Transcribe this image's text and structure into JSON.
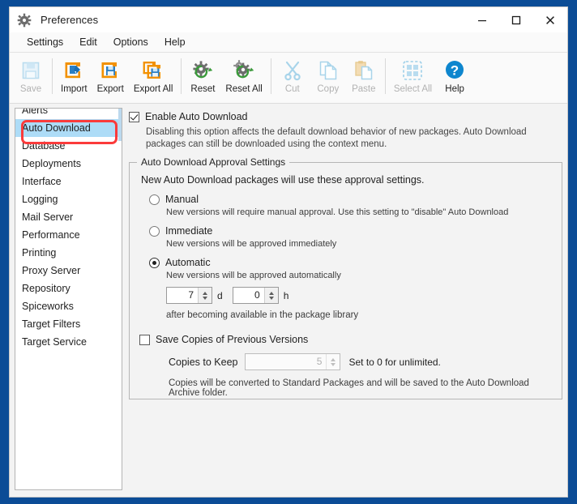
{
  "window": {
    "title": "Preferences",
    "icon": "gear-icon",
    "controls": {
      "minimize": "—",
      "maximize": "▢",
      "close": "✕"
    },
    "border_color": "#0b4c96"
  },
  "menubar": {
    "items": [
      "Settings",
      "Edit",
      "Options",
      "Help"
    ]
  },
  "toolbar": {
    "buttons": [
      {
        "label": "Save",
        "icon": "save-disk-icon",
        "enabled": false
      },
      {
        "label": "Import",
        "icon": "import-icon",
        "enabled": true
      },
      {
        "label": "Export",
        "icon": "export-icon",
        "enabled": true
      },
      {
        "label": "Export All",
        "icon": "export-all-icon",
        "enabled": true
      },
      {
        "label": "Reset",
        "icon": "reset-gear-icon",
        "enabled": true
      },
      {
        "label": "Reset All",
        "icon": "reset-all-gear-icon",
        "enabled": true
      },
      {
        "label": "Cut",
        "icon": "scissors-icon",
        "enabled": false
      },
      {
        "label": "Copy",
        "icon": "copy-pages-icon",
        "enabled": false
      },
      {
        "label": "Paste",
        "icon": "paste-clipboard-icon",
        "enabled": false
      },
      {
        "label": "Select All",
        "icon": "select-all-icon",
        "enabled": false
      },
      {
        "label": "Help",
        "icon": "help-question-icon",
        "enabled": true
      }
    ],
    "separators_after": [
      0,
      3,
      5,
      9
    ],
    "help_accent": "#0e86ce",
    "accent_orange": "#f29100"
  },
  "sidebar": {
    "items": [
      {
        "label": "Alerts",
        "selected": false
      },
      {
        "label": "Auto Download",
        "selected": true
      },
      {
        "label": "Database",
        "selected": false
      },
      {
        "label": "Deployments",
        "selected": false
      },
      {
        "label": "Interface",
        "selected": false
      },
      {
        "label": "Logging",
        "selected": false
      },
      {
        "label": "Mail Server",
        "selected": false
      },
      {
        "label": "Performance",
        "selected": false
      },
      {
        "label": "Printing",
        "selected": false
      },
      {
        "label": "Proxy Server",
        "selected": false
      },
      {
        "label": "Repository",
        "selected": false
      },
      {
        "label": "Spiceworks",
        "selected": false
      },
      {
        "label": "Target Filters",
        "selected": false
      },
      {
        "label": "Target Service",
        "selected": false
      }
    ],
    "selection_color": "#addcf7",
    "annotation_color": "#fb3b3b"
  },
  "main": {
    "enable": {
      "label": "Enable Auto Download",
      "checked": true,
      "description": "Disabling this option affects the default download behavior of new packages. Auto Download packages can still be downloaded using the context menu."
    },
    "group": {
      "title": "Auto Download Approval Settings",
      "intro": "New Auto Download packages will use these approval settings.",
      "options": [
        {
          "label": "Manual",
          "selected": false,
          "description": "New versions will require manual approval. Use this setting to \"disable\" Auto Download"
        },
        {
          "label": "Immediate",
          "selected": false,
          "description": "New versions will be approved immediately"
        },
        {
          "label": "Automatic",
          "selected": true,
          "description": "New versions will be approved automatically"
        }
      ],
      "delay": {
        "days_value": "7",
        "days_unit": "d",
        "hours_value": "0",
        "hours_unit": "h",
        "after_note": "after becoming available in the package library"
      },
      "save_copies": {
        "label": "Save Copies of Previous Versions",
        "checked": false,
        "keep_label": "Copies to Keep",
        "keep_value": "5",
        "keep_enabled": false,
        "keep_note": "Set to 0 for unlimited.",
        "footer_note": "Copies will be converted to Standard Packages and will be saved to the Auto Download Archive folder."
      }
    }
  }
}
